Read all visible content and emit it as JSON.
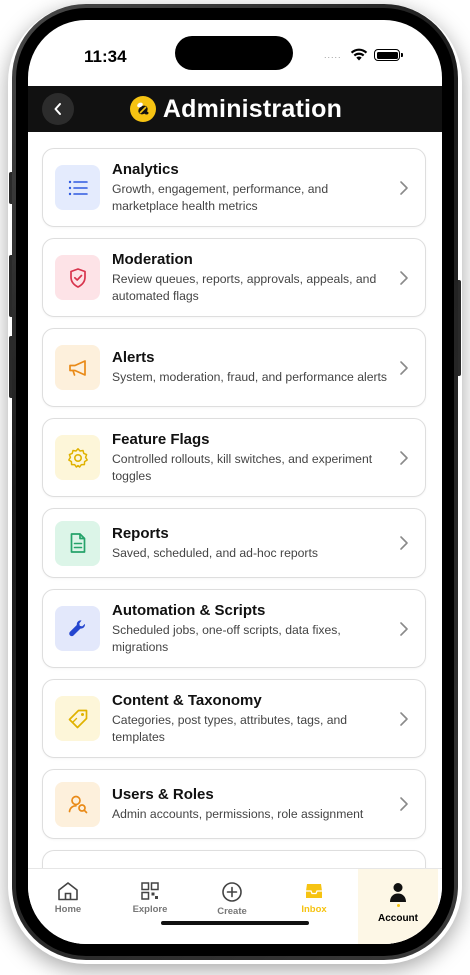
{
  "status_bar": {
    "time": "11:34",
    "signal": "....."
  },
  "header": {
    "title": "Administration"
  },
  "menu_items": [
    {
      "title": "Analytics",
      "desc": "Growth, engagement, performance, and marketplace health metrics",
      "icon": "list-icon",
      "color": "#2f5be0",
      "bg": "#e4ebfd"
    },
    {
      "title": "Moderation",
      "desc": "Review queues, reports, approvals, appeals, and automated flags",
      "icon": "shield-check-icon",
      "color": "#d8344d",
      "bg": "#fde3e7"
    },
    {
      "title": "Alerts",
      "desc": "System, moderation, fraud, and performance alerts",
      "icon": "megaphone-icon",
      "color": "#e98a17",
      "bg": "#fdf0dc"
    },
    {
      "title": "Feature Flags",
      "desc": "Controlled rollouts, kill switches, and experiment toggles",
      "icon": "gear-icon",
      "color": "#e0b200",
      "bg": "#fdf6d9"
    },
    {
      "title": "Reports",
      "desc": "Saved, scheduled, and ad-hoc reports",
      "icon": "document-icon",
      "color": "#25a36a",
      "bg": "#dcf5e8"
    },
    {
      "title": "Automation & Scripts",
      "desc": "Scheduled jobs, one-off scripts, data fixes, migrations",
      "icon": "wrench-icon",
      "color": "#2546cf",
      "bg": "#e3e8fb"
    },
    {
      "title": "Content & Taxonomy",
      "desc": "Categories, post types, attributes, tags, and templates",
      "icon": "tag-icon",
      "color": "#e0b200",
      "bg": "#fdf6d9"
    },
    {
      "title": "Users & Roles",
      "desc": "Admin accounts, permissions, role assignment",
      "icon": "user-search-icon",
      "color": "#e98a17",
      "bg": "#fdf0dc"
    }
  ],
  "tab_bar": {
    "home": "Home",
    "explore": "Explore",
    "create": "Create",
    "inbox": "Inbox",
    "account": "Account"
  },
  "colors": {
    "accent": "#f6c312",
    "header_bg": "#111111"
  }
}
